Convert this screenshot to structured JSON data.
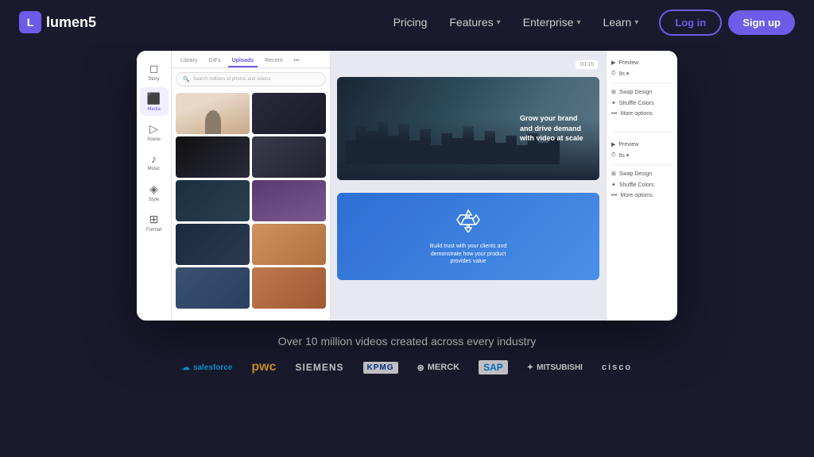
{
  "navbar": {
    "logo_text": "lumen5",
    "nav_items": [
      {
        "label": "Pricing",
        "has_dropdown": false
      },
      {
        "label": "Features",
        "has_dropdown": true
      },
      {
        "label": "Enterprise",
        "has_dropdown": true
      },
      {
        "label": "Learn",
        "has_dropdown": true
      }
    ],
    "login_label": "Log in",
    "signup_label": "Sign up"
  },
  "app": {
    "sidebar_items": [
      {
        "label": "Story",
        "icon": "📄"
      },
      {
        "label": "Media",
        "icon": "🖼️",
        "active": true
      },
      {
        "label": "Scene",
        "icon": "🎬"
      },
      {
        "label": "Music",
        "icon": "🎵"
      },
      {
        "label": "Style",
        "icon": "🎨"
      },
      {
        "label": "Format",
        "icon": "📐"
      }
    ],
    "media_tabs": [
      "Library",
      "GIFs",
      "Uploads",
      "Recent"
    ],
    "active_tab": "Uploads",
    "search_placeholder": "Search millions of photos and videos",
    "slide1_text": "Grow your brand and drive demand with video at scale",
    "slide2_text": "Build trust with your clients and demonstrate how your product provides value",
    "panel_items_slide1": [
      "Preview",
      "9s",
      "Swap Design",
      "Shuffle Colors",
      "More options"
    ],
    "panel_items_slide2": [
      "Preview",
      "9s",
      "Swap Design",
      "Shuffle Colors",
      "More options"
    ]
  },
  "social_proof": {
    "tagline": "Over 10 million videos created across every industry",
    "logos": [
      {
        "name": "Salesforce",
        "style": "salesforce"
      },
      {
        "name": "PwC",
        "style": "pwc"
      },
      {
        "name": "SIEMENS",
        "style": "siemens"
      },
      {
        "name": "KPMG",
        "style": "kpmg"
      },
      {
        "name": "MERCK",
        "style": "merck"
      },
      {
        "name": "SAP",
        "style": "sap"
      },
      {
        "name": "MITSUBISHI",
        "style": "mitsubishi"
      },
      {
        "name": "cisco",
        "style": "cisco"
      }
    ]
  }
}
